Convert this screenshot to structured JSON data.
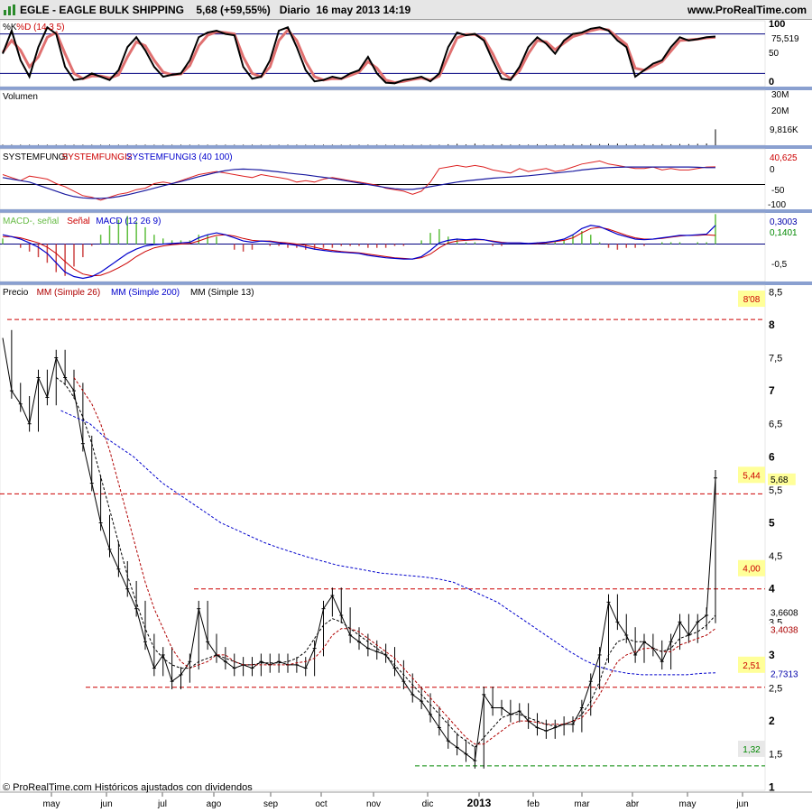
{
  "header": {
    "title": "EGLE - EAGLE BULK SHIPPING    5,68 (+59,55%)   Diario  16 may 2013 14:19",
    "site": "www.ProRealTime.com"
  },
  "footer": {
    "credit": "© ProRealTime.com  Históricos ajustados con dividendos"
  },
  "colors": {
    "price": "#000000",
    "sma26": "#b00000",
    "sma200": "#0000cc",
    "sma13": "#000000",
    "stoch_k": "#000000",
    "stoch_d": "#e07070",
    "macd_hist": "#5fbf3f",
    "macd_fill": "#f0a0a0",
    "panel_sep": "#8aa0d0",
    "level_red": "#cc0000",
    "level_green": "#008800",
    "tag_bg": "#ffff99"
  },
  "chart_data": [
    {
      "type": "line",
      "panel": "stochastic",
      "legend": [
        {
          "text": "%K",
          "color": "#000000"
        },
        {
          "text": "%D (14 3 5)",
          "color": "#cc0000"
        }
      ],
      "ylim": [
        0,
        100
      ],
      "y_ticks": [
        "100",
        "50",
        "0"
      ],
      "current_value_label": "75,519",
      "reference_levels": [
        80,
        20
      ],
      "series": [
        {
          "name": "%K",
          "values": [
            50,
            85,
            40,
            15,
            60,
            90,
            80,
            30,
            10,
            12,
            20,
            15,
            10,
            25,
            60,
            75,
            55,
            30,
            15,
            18,
            20,
            40,
            75,
            82,
            85,
            80,
            78,
            30,
            12,
            15,
            40,
            85,
            90,
            60,
            25,
            8,
            10,
            15,
            12,
            20,
            25,
            45,
            20,
            6,
            5,
            10,
            12,
            15,
            8,
            20,
            60,
            82,
            78,
            80,
            70,
            40,
            12,
            10,
            30,
            60,
            75,
            65,
            50,
            70,
            80,
            82,
            88,
            90,
            85,
            70,
            60,
            15,
            25,
            35,
            40,
            60,
            75,
            70,
            72,
            75,
            76
          ]
        },
        {
          "name": "%D",
          "values": [
            52,
            70,
            55,
            30,
            45,
            75,
            82,
            50,
            20,
            12,
            16,
            16,
            13,
            18,
            45,
            68,
            62,
            40,
            22,
            18,
            19,
            32,
            62,
            78,
            83,
            82,
            80,
            45,
            20,
            15,
            30,
            70,
            86,
            70,
            38,
            15,
            10,
            12,
            12,
            17,
            22,
            38,
            28,
            10,
            6,
            8,
            11,
            13,
            10,
            16,
            45,
            74,
            79,
            79,
            73,
            50,
            22,
            12,
            24,
            50,
            70,
            68,
            56,
            66,
            76,
            80,
            85,
            88,
            86,
            75,
            64,
            28,
            25,
            31,
            38,
            54,
            70,
            71,
            72,
            74,
            75
          ]
        }
      ]
    },
    {
      "type": "bar",
      "panel": "volume",
      "legend": [
        {
          "text": "Volumen",
          "color": "#000000"
        }
      ],
      "y_ticks": [
        "30M",
        "20M"
      ],
      "current_value_label": "9,816K",
      "values": [
        0.3,
        0.2,
        0.3,
        0.2,
        0.2,
        0.3,
        0.2,
        0.2,
        0.3,
        0.2,
        0.2,
        0.3,
        0.2,
        0.2,
        0.3,
        0.3,
        0.2,
        0.3,
        0.2,
        0.2,
        0.3,
        0.3,
        0.2,
        0.3,
        0.2,
        0.3,
        0.2,
        0.2,
        0.3,
        0.2,
        0.2,
        0.3,
        0.2,
        0.3,
        0.2,
        0.2,
        0.3,
        0.2,
        0.2,
        0.3,
        0.2,
        0.2,
        0.3,
        0.2,
        0.3,
        0.2,
        0.3,
        0.3,
        0.2,
        0.3,
        0.6,
        0.9,
        0.5,
        1.0,
        0.4,
        0.5,
        0.6,
        0.4,
        0.5,
        0.4,
        0.6,
        0.5,
        0.5,
        0.6,
        0.7,
        0.6,
        0.8,
        0.7,
        0.9,
        1.0,
        0.7,
        0.6,
        0.6,
        0.6,
        0.7,
        0.6,
        0.8,
        0.7,
        0.9,
        1.1,
        9.816
      ]
    },
    {
      "type": "line",
      "panel": "systemfungi",
      "legend": [
        {
          "text": "SYSTEMFUNGI",
          "color": "#000000"
        },
        {
          "text": "SYSTEMFUNGI2",
          "color": "#cc0000"
        },
        {
          "text": "SYSTEMFUNGI3 (40 100)",
          "color": "#0000cc"
        }
      ],
      "ylim": [
        -100,
        100
      ],
      "y_ticks": [
        "0",
        "-50",
        "-100"
      ],
      "current_value_label": "40,625",
      "current_value_zero": "0",
      "series": [
        {
          "name": "SYSTEMFUNGI2",
          "values": [
            15,
            5,
            -5,
            10,
            5,
            0,
            -15,
            -25,
            -40,
            -55,
            -60,
            -70,
            -60,
            -50,
            -45,
            -35,
            -30,
            -15,
            -10,
            -15,
            -5,
            5,
            15,
            20,
            25,
            20,
            15,
            10,
            5,
            15,
            10,
            5,
            0,
            -10,
            -5,
            -10,
            0,
            5,
            0,
            -5,
            -10,
            -15,
            -20,
            -30,
            -35,
            -40,
            -50,
            -40,
            -10,
            35,
            40,
            45,
            40,
            45,
            40,
            30,
            25,
            20,
            35,
            25,
            30,
            35,
            25,
            30,
            40,
            50,
            55,
            60,
            50,
            45,
            40,
            35,
            35,
            40,
            30,
            35,
            30,
            30,
            35,
            40,
            40.625
          ]
        },
        {
          "name": "SYSTEMFUNGI3",
          "values": [
            5,
            0,
            -5,
            -10,
            -20,
            -30,
            -40,
            -50,
            -58,
            -62,
            -64,
            -64,
            -62,
            -58,
            -52,
            -45,
            -38,
            -30,
            -22,
            -15,
            -8,
            0,
            8,
            15,
            22,
            28,
            32,
            33,
            32,
            30,
            27,
            24,
            20,
            17,
            14,
            10,
            6,
            2,
            -3,
            -8,
            -13,
            -18,
            -23,
            -28,
            -32,
            -34,
            -34,
            -30,
            -25,
            -20,
            -15,
            -10,
            -6,
            -3,
            0,
            3,
            5,
            7,
            9,
            11,
            14,
            17,
            20,
            23,
            26,
            30,
            33,
            36,
            38,
            39,
            40,
            40,
            40,
            40,
            40,
            40,
            40,
            40,
            39,
            38,
            38
          ]
        }
      ]
    },
    {
      "type": "line",
      "panel": "macd",
      "legend": [
        {
          "text": "MACD-, señal",
          "color": "#66bb44"
        },
        {
          "text": "Señal",
          "color": "#cc0000"
        },
        {
          "text": "MACD (12 26 9)",
          "color": "#0000cc"
        }
      ],
      "ylim": [
        -0.6,
        0.5
      ],
      "y_ticks": [
        "-0,5"
      ],
      "current_value_labels": [
        "0,3003",
        "0,1401"
      ],
      "series": [
        {
          "name": "MACD",
          "values": [
            0.15,
            0.12,
            0.08,
            0.02,
            -0.05,
            -0.15,
            -0.3,
            -0.45,
            -0.52,
            -0.55,
            -0.52,
            -0.45,
            -0.35,
            -0.25,
            -0.15,
            -0.08,
            -0.03,
            -0.01,
            0,
            0.01,
            0.02,
            0.03,
            0.1,
            0.15,
            0.18,
            0.15,
            0.1,
            0.05,
            0.03,
            0.05,
            0.04,
            0.02,
            0,
            -0.02,
            -0.05,
            -0.08,
            -0.1,
            -0.12,
            -0.13,
            -0.14,
            -0.15,
            -0.18,
            -0.2,
            -0.22,
            -0.23,
            -0.24,
            -0.24,
            -0.2,
            -0.1,
            0.02,
            0.06,
            0.08,
            0.07,
            0.08,
            0.07,
            0.04,
            0.02,
            0.02,
            0.02,
            0.01,
            0.02,
            0.03,
            0.05,
            0.08,
            0.15,
            0.25,
            0.3,
            0.28,
            0.22,
            0.16,
            0.12,
            0.08,
            0.07,
            0.08,
            0.1,
            0.12,
            0.14,
            0.14,
            0.15,
            0.16,
            0.3003
          ]
        },
        {
          "name": "Señal",
          "values": [
            0.12,
            0.12,
            0.1,
            0.06,
            0.02,
            -0.05,
            -0.15,
            -0.28,
            -0.4,
            -0.48,
            -0.51,
            -0.5,
            -0.45,
            -0.38,
            -0.3,
            -0.2,
            -0.12,
            -0.06,
            -0.03,
            -0.01,
            0,
            0.01,
            0.05,
            0.1,
            0.14,
            0.15,
            0.13,
            0.09,
            0.06,
            0.05,
            0.05,
            0.03,
            0.02,
            0,
            -0.02,
            -0.05,
            -0.08,
            -0.1,
            -0.12,
            -0.13,
            -0.14,
            -0.16,
            -0.18,
            -0.2,
            -0.22,
            -0.23,
            -0.24,
            -0.22,
            -0.16,
            -0.06,
            0.02,
            0.05,
            0.06,
            0.07,
            0.07,
            0.05,
            0.03,
            0.02,
            0.02,
            0.01,
            0.01,
            0.02,
            0.04,
            0.06,
            0.1,
            0.18,
            0.25,
            0.27,
            0.24,
            0.19,
            0.14,
            0.1,
            0.08,
            0.08,
            0.09,
            0.11,
            0.13,
            0.14,
            0.14,
            0.15,
            0.1401
          ]
        }
      ]
    },
    {
      "type": "line",
      "panel": "price",
      "legend": [
        {
          "text": "Precio",
          "color": "#000000"
        },
        {
          "text": "MM (Simple 26)",
          "color": "#b00000"
        },
        {
          "text": "MM (Simple 200)",
          "color": "#0000cc"
        },
        {
          "text": "MM (Simple 13)",
          "color": "#000000"
        }
      ],
      "ylim": [
        0.95,
        8.6
      ],
      "y_ticks": [
        "8,5",
        "8",
        "7,5",
        "7",
        "6,5",
        "6",
        "5,5",
        "5",
        "4,5",
        "4",
        "3,5",
        "3",
        "2,5",
        "2",
        "1,5",
        "1"
      ],
      "x_tick_labels": [
        "may",
        "jun",
        "jul",
        "ago",
        "sep",
        "oct",
        "nov",
        "dic",
        "2013",
        "feb",
        "mar",
        "abr",
        "may",
        "jun"
      ],
      "levels": [
        {
          "value": 8.08,
          "label": "8'08",
          "color": "#cc0000"
        },
        {
          "value": 5.44,
          "label": "5,44",
          "color": "#cc0000"
        },
        {
          "value": 4.0,
          "label": "4,00",
          "color": "#cc0000"
        },
        {
          "value": 2.51,
          "label": "2,51",
          "color": "#cc0000"
        },
        {
          "value": 1.32,
          "label": "1,32",
          "color": "#008800"
        }
      ],
      "value_tags": [
        {
          "value": 5.68,
          "label": "5,68"
        },
        {
          "value": 3.6608,
          "label": "3,6608"
        },
        {
          "value": 3.4038,
          "label": "3,4038"
        },
        {
          "value": 2.7313,
          "label": "2,7313"
        }
      ],
      "series": [
        {
          "name": "Precio",
          "values": [
            7.8,
            7.0,
            6.8,
            6.5,
            7.2,
            6.9,
            7.5,
            7.2,
            7.0,
            6.2,
            5.6,
            5.0,
            4.6,
            4.3,
            4.0,
            3.7,
            3.2,
            2.8,
            3.0,
            2.6,
            2.7,
            2.9,
            3.7,
            3.2,
            3.0,
            2.9,
            2.8,
            2.85,
            2.8,
            2.9,
            2.85,
            2.9,
            2.85,
            2.85,
            2.8,
            3.1,
            3.7,
            3.9,
            3.6,
            3.3,
            3.2,
            3.1,
            3.05,
            3.0,
            2.8,
            2.6,
            2.4,
            2.3,
            2.1,
            1.9,
            1.7,
            1.6,
            1.5,
            1.4,
            2.4,
            2.2,
            2.2,
            2.1,
            2.15,
            2.0,
            1.9,
            1.85,
            1.9,
            1.95,
            1.95,
            2.2,
            2.6,
            3.0,
            3.8,
            3.5,
            3.3,
            3.0,
            3.2,
            3.1,
            2.9,
            3.2,
            3.5,
            3.3,
            3.5,
            3.6,
            5.68
          ]
        },
        {
          "name": "MM (Simple 26)",
          "values": [
            null,
            null,
            null,
            null,
            null,
            null,
            null,
            null,
            7.2,
            7.0,
            6.8,
            6.5,
            6.1,
            5.6,
            5.1,
            4.6,
            4.1,
            3.7,
            3.4,
            3.1,
            2.9,
            2.8,
            2.85,
            2.9,
            3.0,
            3.0,
            2.9,
            2.85,
            2.85,
            2.85,
            2.85,
            2.85,
            2.85,
            2.88,
            2.9,
            2.95,
            3.1,
            3.3,
            3.4,
            3.4,
            3.35,
            3.25,
            3.15,
            3.05,
            2.95,
            2.8,
            2.65,
            2.5,
            2.35,
            2.2,
            2.05,
            1.9,
            1.75,
            1.65,
            1.65,
            1.75,
            1.85,
            1.95,
            2.0,
            2.0,
            1.98,
            1.95,
            1.95,
            1.95,
            2.0,
            2.05,
            2.2,
            2.4,
            2.65,
            2.9,
            3.0,
            3.05,
            3.1,
            3.1,
            3.05,
            3.05,
            3.15,
            3.2,
            3.25,
            3.3,
            3.4
          ]
        },
        {
          "name": "MM (Simple 200)",
          "values": [
            null,
            null,
            null,
            null,
            6.7,
            6.6,
            6.5,
            6.3,
            6.15,
            6.0,
            5.8,
            5.6,
            5.45,
            5.3,
            5.15,
            5.0,
            4.9,
            4.8,
            4.7,
            4.62,
            4.55,
            4.48,
            4.42,
            4.36,
            4.32,
            4.28,
            4.24,
            4.22,
            4.2,
            4.18,
            4.15,
            4.1,
            4.0,
            3.9,
            3.8,
            3.65,
            3.5,
            3.35,
            3.2,
            3.05,
            2.92,
            2.82,
            2.76,
            2.72,
            2.7,
            2.7,
            2.7,
            2.7,
            2.72,
            2.73
          ]
        },
        {
          "name": "MM (Simple 13)",
          "values": [
            null,
            null,
            null,
            null,
            null,
            null,
            7.2,
            7.1,
            6.9,
            6.6,
            6.2,
            5.7,
            5.2,
            4.7,
            4.2,
            3.8,
            3.4,
            3.1,
            2.95,
            2.85,
            2.8,
            2.8,
            2.9,
            2.95,
            3.0,
            2.95,
            2.9,
            2.85,
            2.85,
            2.88,
            2.88,
            2.88,
            2.9,
            2.95,
            3.05,
            3.25,
            3.45,
            3.55,
            3.5,
            3.4,
            3.3,
            3.2,
            3.1,
            3.0,
            2.85,
            2.7,
            2.55,
            2.4,
            2.25,
            2.1,
            1.95,
            1.8,
            1.7,
            1.6,
            1.75,
            1.9,
            2.05,
            2.1,
            2.1,
            2.05,
            2.0,
            1.95,
            1.92,
            1.95,
            2.0,
            2.1,
            2.3,
            2.6,
            3.0,
            3.2,
            3.25,
            3.2,
            3.2,
            3.1,
            3.05,
            3.1,
            3.25,
            3.3,
            3.35,
            3.45,
            3.6
          ]
        }
      ]
    }
  ]
}
